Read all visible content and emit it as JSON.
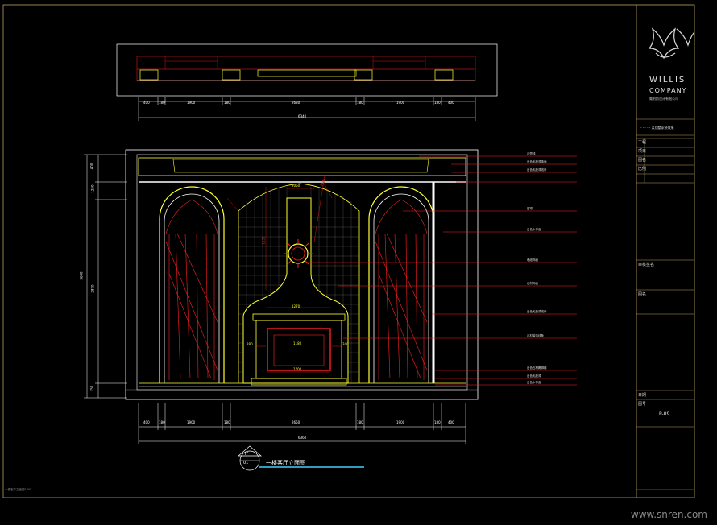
{
  "title_block": {
    "company_line1": "WILLIS",
    "company_line2": "COMPANY",
    "company_tagline": "威利斯设计有限公司",
    "project_caption": "- - - - - 某别墅家装效果",
    "fields": [
      "工程",
      "项目",
      "图名",
      "比例",
      "",
      "",
      "",
      "",
      "",
      "审核签名",
      "",
      "图名",
      "",
      "",
      "",
      "",
      "",
      "日期",
      "图号"
    ],
    "drawing_number": "P-09"
  },
  "drawing": {
    "title": "一楼客厅立面图",
    "marker_top": "IF",
    "marker_bottom": "01",
    "plan_dims": [
      "400",
      "180",
      "1900",
      "180",
      "2630",
      "180",
      "1900",
      "180",
      "400"
    ],
    "plan_total": "6340",
    "elev_dims": [
      "400",
      "180",
      "1900",
      "180",
      "2650",
      "180",
      "1900",
      "180",
      "400"
    ],
    "elev_total": "6360",
    "left_dims": [
      "400",
      "1250",
      "2870",
      "150"
    ],
    "left_total": "3600",
    "inner_labels": [
      "2050",
      "1270",
      "1180",
      "1700",
      "1150",
      "2500",
      "280",
      "340"
    ],
    "callouts": [
      "石膏线",
      "白色乳胶漆饰面",
      "白色乳胶漆线条",
      "窗帘",
      "白色木饰面",
      "墙纸饰面",
      "石材饰面",
      "白色乳胶漆线条",
      "石材装饰线条",
      "白色石材踢脚线",
      "白色乳胶漆",
      "白色木饰面"
    ]
  },
  "footer": {
    "left_note": "一楼客厅立面图1:50",
    "watermark": "www.snren.com"
  },
  "colors": {
    "background": "#000000",
    "frame": "#b8a060",
    "cad_red": "#ff2020",
    "cad_yellow": "#ffff30",
    "cad_white": "#ffffff",
    "cad_cyan": "#3fd0ff"
  }
}
